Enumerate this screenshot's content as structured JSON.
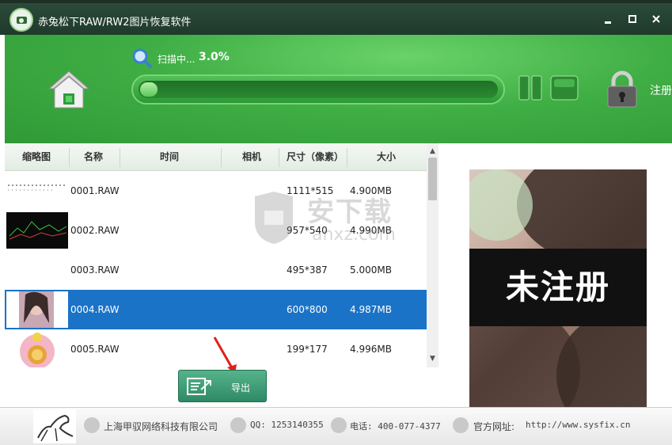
{
  "window": {
    "title": "赤兔松下RAW/RW2图片恢复软件",
    "controls": [
      "▪",
      "×"
    ]
  },
  "scan": {
    "label": "扫描中...",
    "percent_text": "3.0%",
    "progress": 0.03
  },
  "register": {
    "label": "注册"
  },
  "table": {
    "headers": [
      "缩略图",
      "名称",
      "时间",
      "相机",
      "尺寸（像素）",
      "大小"
    ],
    "rows": [
      {
        "name": "0001.RAW",
        "time": "",
        "camera": "",
        "size_px": "1111*515",
        "size": "4.900MB",
        "selected": false
      },
      {
        "name": "0002.RAW",
        "time": "",
        "camera": "",
        "size_px": "957*540",
        "size": "4.990MB",
        "selected": false
      },
      {
        "name": "0003.RAW",
        "time": "",
        "camera": "",
        "size_px": "495*387",
        "size": "5.000MB",
        "selected": false
      },
      {
        "name": "0004.RAW",
        "time": "",
        "camera": "",
        "size_px": "600*800",
        "size": "4.987MB",
        "selected": true
      },
      {
        "name": "0005.RAW",
        "time": "",
        "camera": "",
        "size_px": "199*177",
        "size": "4.996MB",
        "selected": false
      }
    ]
  },
  "preview": {
    "overlay_text": "未注册"
  },
  "export": {
    "label": "导出"
  },
  "watermark": {
    "text": "安下载",
    "sub": "anxz.com"
  },
  "footer": {
    "company": "上海甲驭网络科技有限公司",
    "qq": "QQ: 1253140355",
    "phone": "电话: 400-077-4377",
    "website_label": "官方网址: ",
    "website": "http://www.sysfix.cn"
  },
  "colors": {
    "header_green": "#3fae44",
    "selected_row": "#1a73c7",
    "titlebar": "#1f3a2c"
  }
}
